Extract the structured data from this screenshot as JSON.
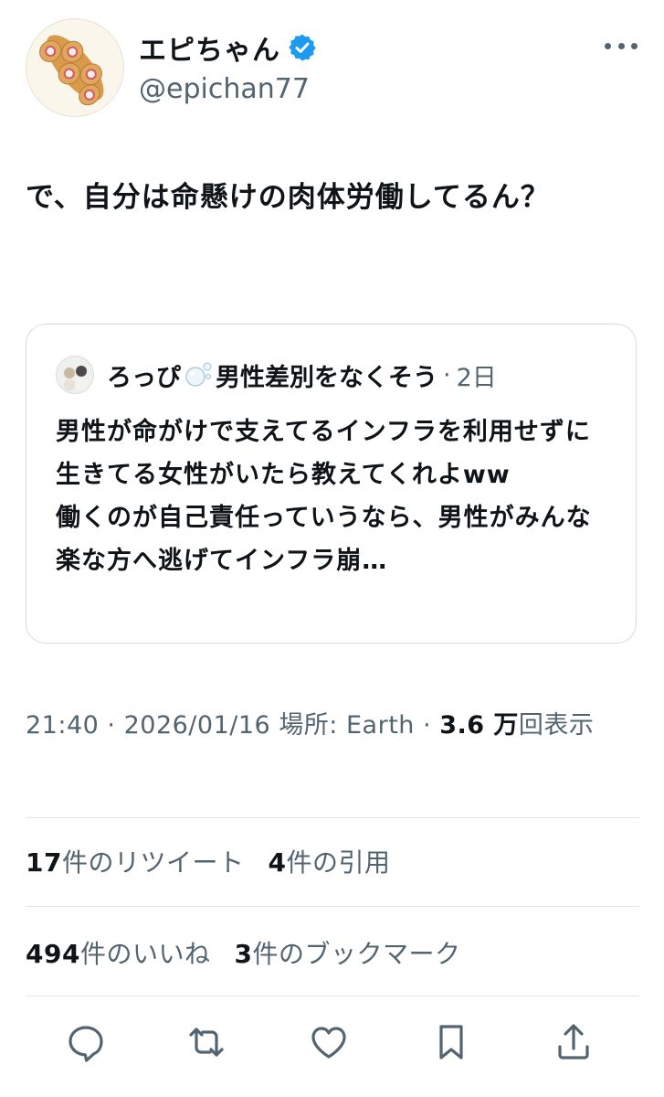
{
  "author": {
    "display_name": "エピちゃん",
    "handle": "@epichan77",
    "verified_icon": "verified-badge-icon",
    "badge_color": "#1d9bf0"
  },
  "tweet": {
    "text": "で、自分は命懸けの肉体労働してるん？"
  },
  "quoted_tweet": {
    "display_name": "ろっぴ",
    "name_suffix": "男性差別をなくそう",
    "separator": "·",
    "date": "2日",
    "text": "男性が命がけで支えてるインフラを利用せずに生きてる女性がいたら教えてくれよww\n働くのが自己責任っていうなら、男性がみんな楽な方へ逃げてインフラ崩…"
  },
  "meta": {
    "time": "21:40",
    "sep1": "·",
    "date": "2026/01/16",
    "location": "場所: Earth",
    "sep2": "·",
    "views_count": "3.6 万",
    "views_label": "回表示"
  },
  "stats": {
    "retweets_count": "17",
    "retweets_label": "件のリツイート",
    "quotes_count": "4",
    "quotes_label": "件の引用",
    "likes_count": "494",
    "likes_label": "件のいいね",
    "bookmarks_count": "3",
    "bookmarks_label": "件のブックマーク"
  },
  "actions": [
    "reply-icon",
    "retweet-icon",
    "like-icon",
    "bookmark-icon",
    "share-icon"
  ],
  "colors": {
    "text": "#0f1419",
    "secondary": "#536471",
    "border": "#d6dce0"
  }
}
